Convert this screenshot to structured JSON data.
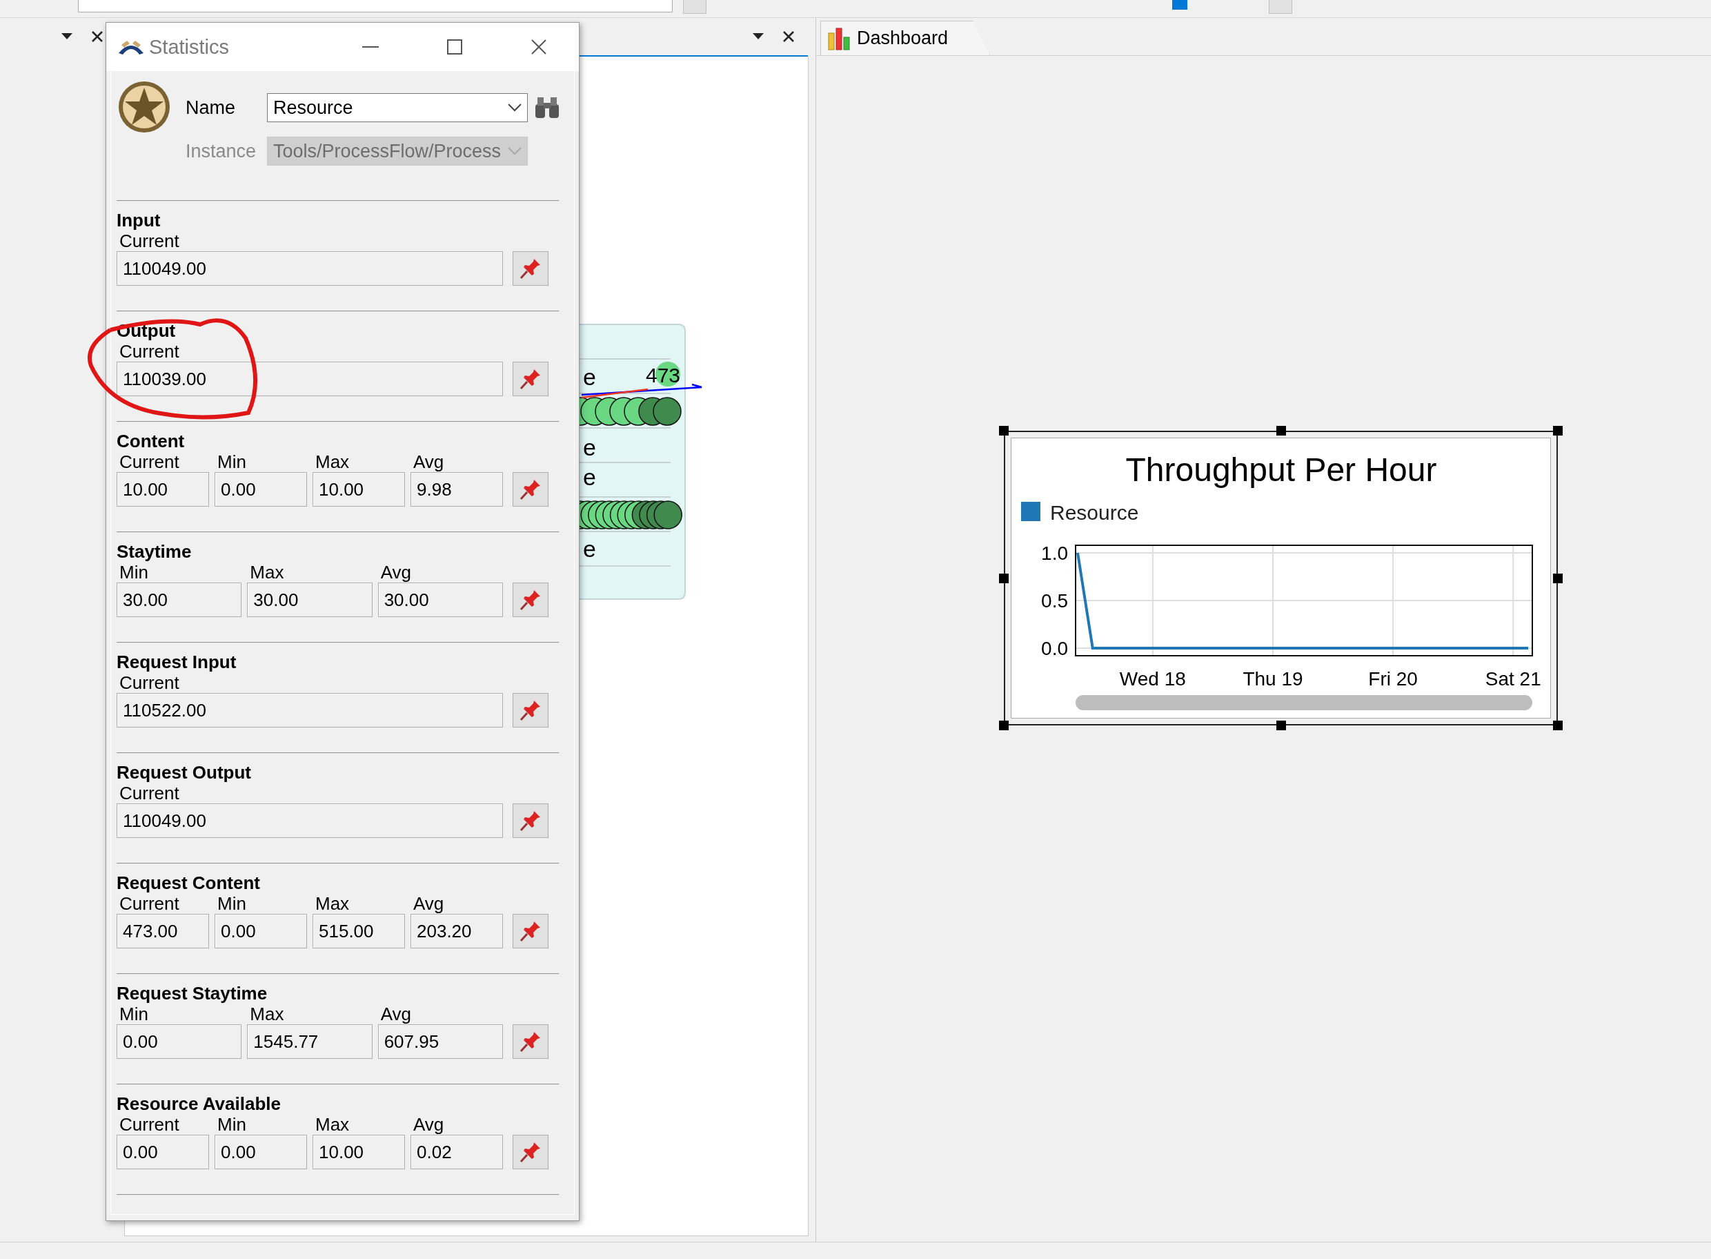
{
  "dashboard_tab": {
    "label": "Dashboard"
  },
  "process_flow": {
    "fragments": [
      "e",
      "e",
      "e",
      "e"
    ],
    "badge": "473"
  },
  "statistics_window": {
    "title": "Statistics",
    "name_label": "Name",
    "name_value": "Resource",
    "instance_label": "Instance",
    "instance_value": "Tools/ProcessFlow/Process",
    "instance_disabled": true,
    "sections": [
      {
        "title": "Input",
        "fields": [
          {
            "label": "Current",
            "value": "110049.00"
          }
        ]
      },
      {
        "title": "Output",
        "fields": [
          {
            "label": "Current",
            "value": "110039.00"
          }
        ]
      },
      {
        "title": "Content",
        "fields": [
          {
            "label": "Current",
            "value": "10.00"
          },
          {
            "label": "Min",
            "value": "0.00"
          },
          {
            "label": "Max",
            "value": "10.00"
          },
          {
            "label": "Avg",
            "value": "9.98"
          }
        ]
      },
      {
        "title": "Staytime",
        "fields": [
          {
            "label": "Min",
            "value": "30.00"
          },
          {
            "label": "Max",
            "value": "30.00"
          },
          {
            "label": "Avg",
            "value": "30.00"
          }
        ]
      },
      {
        "title": "Request Input",
        "fields": [
          {
            "label": "Current",
            "value": "110522.00"
          }
        ]
      },
      {
        "title": "Request Output",
        "fields": [
          {
            "label": "Current",
            "value": "110049.00"
          }
        ]
      },
      {
        "title": "Request Content",
        "fields": [
          {
            "label": "Current",
            "value": "473.00"
          },
          {
            "label": "Min",
            "value": "0.00"
          },
          {
            "label": "Max",
            "value": "515.00"
          },
          {
            "label": "Avg",
            "value": "203.20"
          }
        ]
      },
      {
        "title": "Request Staytime",
        "fields": [
          {
            "label": "Min",
            "value": "0.00"
          },
          {
            "label": "Max",
            "value": "1545.77"
          },
          {
            "label": "Avg",
            "value": "607.95"
          }
        ]
      },
      {
        "title": "Resource Available",
        "fields": [
          {
            "label": "Current",
            "value": "0.00"
          },
          {
            "label": "Min",
            "value": "0.00"
          },
          {
            "label": "Max",
            "value": "10.00"
          },
          {
            "label": "Avg",
            "value": "0.02"
          }
        ]
      }
    ]
  },
  "dashboard": {
    "chart_data": {
      "type": "line",
      "title": "Throughput Per Hour",
      "grid": true,
      "categories": [
        null,
        null,
        null,
        null,
        null,
        "Wed 18",
        null,
        null,
        null,
        null,
        null,
        null,
        null,
        "Thu 19",
        null,
        null,
        null,
        null,
        null,
        null,
        null,
        "Fri 20",
        null,
        null,
        null,
        null,
        null,
        null,
        null,
        "Sat 21",
        null
      ],
      "ylim": [
        -0.08,
        1.08
      ],
      "yticks": [
        {
          "value": 0,
          "label": "0.0"
        },
        {
          "value": 0.5,
          "label": "0.5"
        },
        {
          "value": 1,
          "label": "1.0"
        }
      ],
      "series": [
        {
          "name": "Resource",
          "color": "#1f77b4",
          "values": [
            1,
            0,
            0,
            0,
            0,
            0,
            0,
            0,
            0,
            0,
            0,
            0,
            0,
            0,
            0,
            0,
            0,
            0,
            0,
            0,
            0,
            0,
            0,
            0,
            0,
            0,
            0,
            0,
            0,
            0,
            0
          ]
        }
      ]
    }
  }
}
